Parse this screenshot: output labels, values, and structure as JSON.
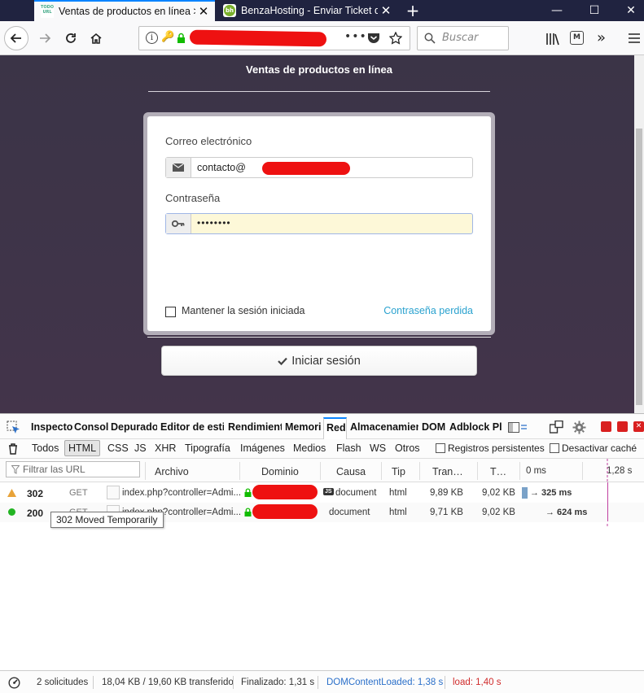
{
  "browser": {
    "tabs": [
      {
        "label": "Ventas de productos en línea > ",
        "active": true
      },
      {
        "label": "BenzaHosting - Enviar Ticket de",
        "active": false
      }
    ],
    "window_controls": {
      "minimize": "—",
      "maximize": "☐",
      "close": "✕"
    },
    "search_placeholder": "Buscar",
    "new_tab": "+"
  },
  "page": {
    "site_title": "Ventas de productos en línea",
    "email_label": "Correo electrónico",
    "email_value": "contacto@",
    "password_label": "Contraseña",
    "password_value": "••••••••",
    "remember_label": "Mantener la sesión iniciada",
    "lost_password": "Contraseña perdida",
    "login_button": "Iniciar sesión"
  },
  "devtools": {
    "tabs": [
      "Inspecto",
      "Consol",
      "Depurado",
      "Editor de estil",
      "Rendimient",
      "Memori",
      "Red",
      "Almacenamien",
      "DOM",
      "Adblock Plu"
    ],
    "selected_tab": "Red",
    "filters": [
      "Todos",
      "HTML",
      "CSS",
      "JS",
      "XHR",
      "Tipografía",
      "Imágenes",
      "Medios",
      "Flash",
      "WS",
      "Otros"
    ],
    "selected_filter": "HTML",
    "persist_logs": "Registros persistentes",
    "disable_cache": "Desactivar caché",
    "url_filter_placeholder": "Filtrar las URL",
    "columns": [
      "Archivo",
      "Dominio",
      "Causa",
      "Tip",
      "Tran…",
      "T…",
      "0 ms",
      "1,28 s"
    ],
    "rows": [
      {
        "status": "302",
        "method": "GET",
        "file": "index.php?controller=Admi...",
        "cause_badge": "JS",
        "cause": "document",
        "type": "html",
        "transferred": "9,89 KB",
        "size": "9,02 KB",
        "timing": "→ 325 ms",
        "status_color": "#e8a33a"
      },
      {
        "status": "200",
        "method": "GET",
        "file": "index.php?controller=Admi...",
        "cause": "document",
        "type": "html",
        "transferred": "9,71 KB",
        "size": "9,02 KB",
        "timing": "→ 624 ms",
        "status_color": "#22b422"
      }
    ],
    "tooltip": "302 Moved Temporarily",
    "status": {
      "requests": "2 solicitudes",
      "transferred": "18,04 KB / 19,60 KB transferido",
      "finished": "Finalizado: 1,31 s",
      "domcontentloaded": "DOMContentLoaded: 1,38 s",
      "load": "load: 1,40 s"
    }
  },
  "colors": {
    "accent": "#0a84ff",
    "link": "#2aa2cf",
    "redact": "#ee1111",
    "dcl": "#2a6fc9",
    "load": "#d02b2b"
  }
}
